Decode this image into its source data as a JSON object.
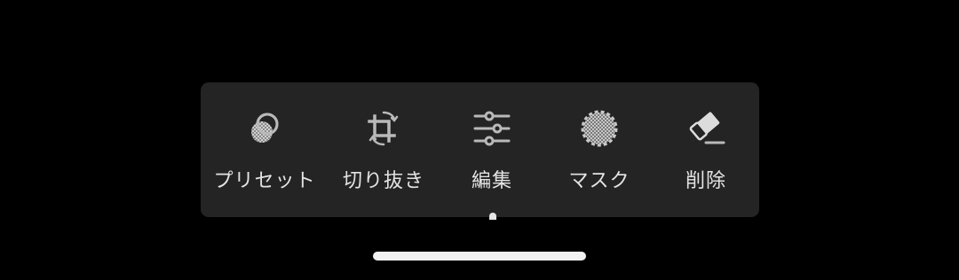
{
  "toolbar": {
    "items": [
      {
        "label": "プリセット",
        "icon": "presets-icon"
      },
      {
        "label": "切り抜き",
        "icon": "crop-rotate-icon"
      },
      {
        "label": "編集",
        "icon": "sliders-icon"
      },
      {
        "label": "マスク",
        "icon": "mask-icon"
      },
      {
        "label": "削除",
        "icon": "eraser-icon"
      }
    ]
  },
  "colors": {
    "background": "#000000",
    "toolbar": "#242424",
    "icon": "#b9b9b9",
    "label": "#e4e4e4"
  }
}
